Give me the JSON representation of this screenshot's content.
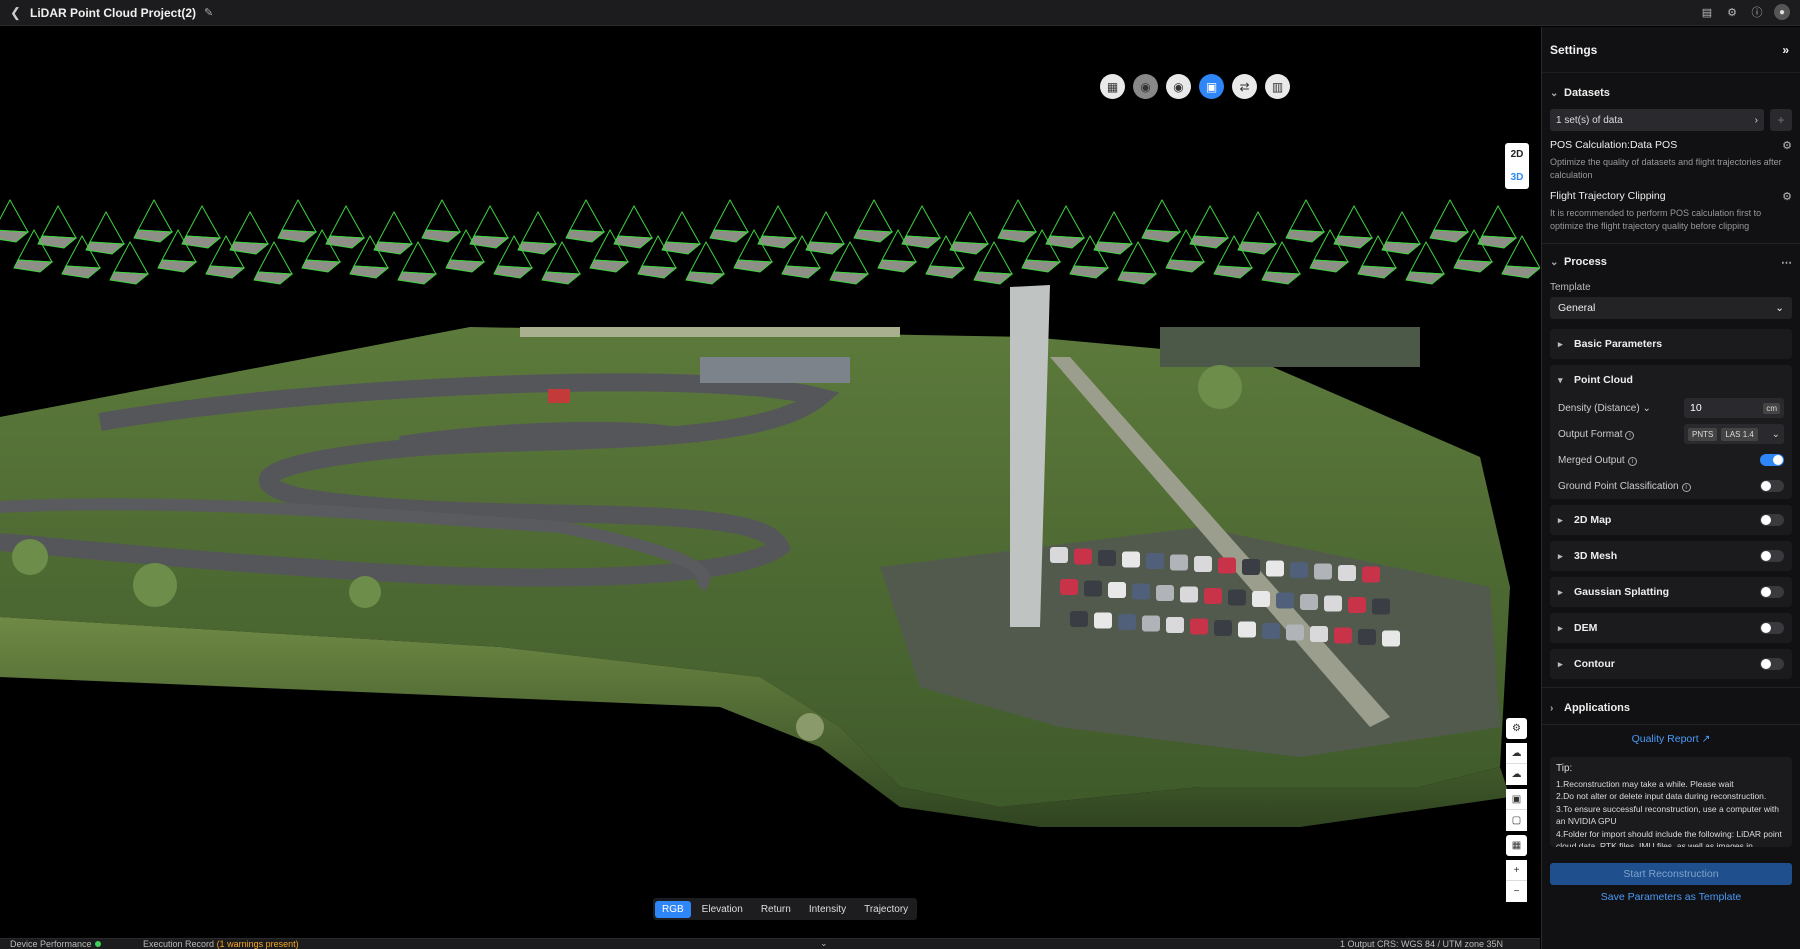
{
  "header": {
    "project_title": "LiDAR Point Cloud Project(2)",
    "icons": [
      "back-icon",
      "edit-icon",
      "task-list-icon",
      "settings-icon",
      "help-icon",
      "user-avatar-icon"
    ]
  },
  "viewport": {
    "view_tools": [
      "grid-icon",
      "location-icon",
      "antenna-icon",
      "camera-icon",
      "swap-icon",
      "chart-icon"
    ],
    "dimension_toggle": {
      "d2": "2D",
      "d3": "3D",
      "active": "3D"
    },
    "render_tabs": [
      {
        "label": "RGB",
        "active": true
      },
      {
        "label": "Elevation",
        "active": false
      },
      {
        "label": "Return",
        "active": false
      },
      {
        "label": "Intensity",
        "active": false
      },
      {
        "label": "Trajectory",
        "active": false
      }
    ]
  },
  "statusbar": {
    "device_performance": "Device Performance",
    "execution_record": "Execution Record",
    "warnings": "(1 warnings present)",
    "output_crs": "1 Output CRS: WGS 84 / UTM zone 35N"
  },
  "settings": {
    "title": "Settings",
    "datasets": {
      "title": "Datasets",
      "selector": "1 set(s) of data",
      "pos_title": "POS Calculation:Data POS",
      "pos_desc": "Optimize the quality of datasets and flight trajectories after calculation",
      "clip_title": "Flight Trajectory Clipping",
      "clip_desc": "It is recommended to perform POS calculation first to optimize the flight trajectory quality before clipping"
    },
    "process": {
      "title": "Process",
      "template_label": "Template",
      "template_value": "General",
      "basic_parameters": "Basic Parameters",
      "point_cloud": {
        "title": "Point Cloud",
        "density_label": "Density (Distance)",
        "density_value": "10",
        "density_unit": "cm",
        "output_format_label": "Output Format",
        "formats": [
          "PNTS",
          "LAS 1.4"
        ],
        "merged_output_label": "Merged Output",
        "merged_output_on": true,
        "ground_label": "Ground Point Classification",
        "ground_on": false
      },
      "modules": [
        {
          "label": "2D Map",
          "on": false
        },
        {
          "label": "3D Mesh",
          "on": false
        },
        {
          "label": "Gaussian Splatting",
          "on": false
        },
        {
          "label": "DEM",
          "on": false
        },
        {
          "label": "Contour",
          "on": false
        }
      ]
    },
    "applications": "Applications",
    "quality_report": "Quality Report",
    "tip": {
      "title": "Tip:",
      "lines": [
        "1.Reconstruction may take a while. Please wait",
        "2.Do not alter or delete input data during reconstruction.",
        "3.To ensure successful reconstruction, use a computer with an NVIDIA GPU",
        "4.Folder for import should include the following: LiDAR point cloud data, RTK files, IMU files, as well as images in"
      ]
    },
    "start_button": "Start Reconstruction",
    "save_template": "Save Parameters as Template"
  },
  "colors": {
    "accent": "#2f86f6",
    "panel_bg": "#111113",
    "warning": "#f5a623",
    "ok": "#3ecf5a"
  }
}
